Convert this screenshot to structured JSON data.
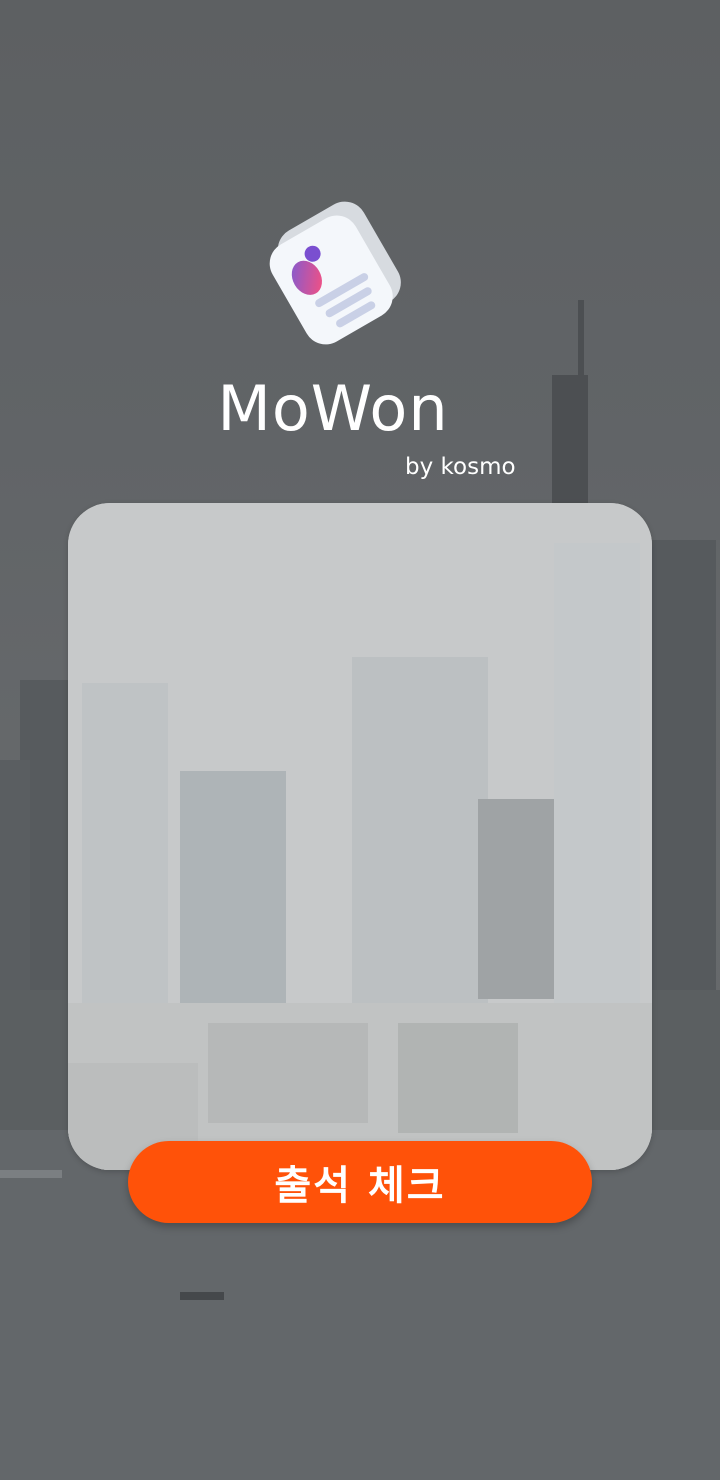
{
  "app": {
    "title": "MoWon",
    "subtitle": "by kosmo",
    "logo_icon": "attendance-app-logo-icon"
  },
  "card": {
    "background_image": "city-skyline-image"
  },
  "actions": {
    "checkin_label": "출석 체크"
  },
  "colors": {
    "accent": "#ff5209",
    "text": "#ffffff",
    "overlay": "#5f6264"
  }
}
